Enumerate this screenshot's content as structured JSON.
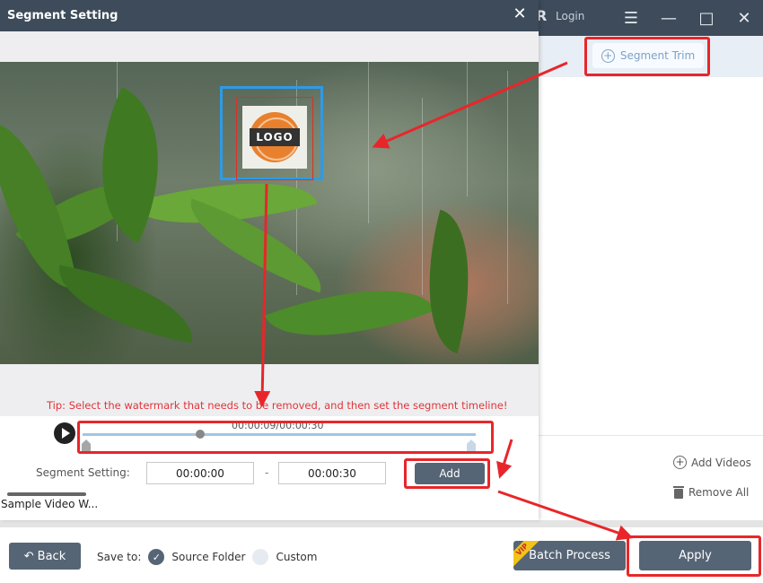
{
  "app": {
    "login_label": "Login",
    "toolbar": {
      "segment_trim_label": "Segment Trim"
    },
    "side_actions": {
      "add_videos_label": "Add Videos",
      "remove_all_label": "Remove All"
    },
    "footer": {
      "back_label": "Back",
      "save_to_label": "Save to:",
      "save_options": [
        {
          "label": "Source Folder",
          "selected": true
        },
        {
          "label": "Custom",
          "selected": false
        }
      ],
      "batch_process_label": "Batch Process",
      "vip_badge": "VIP",
      "apply_label": "Apply"
    },
    "thumbnail_name": "Sample Video W..."
  },
  "dialog": {
    "title": "Segment Setting",
    "watermark_logo_text": "LOGO",
    "tip": "Tip: Select the watermark that needs to be removed, and then set the segment timeline!",
    "timeline": {
      "current_time": "00:00:09",
      "total_time": "00:00:30",
      "readout": "00:00:09/00:00:30",
      "progress_fraction": 0.3
    },
    "segment": {
      "label": "Segment Setting:",
      "start": "00:00:00",
      "separator": "-",
      "end": "00:00:30",
      "add_label": "Add"
    }
  },
  "colors": {
    "header_bg": "#3d4b5a",
    "button_bg": "#566575",
    "annotation_red": "#e8262a",
    "selection_blue": "#2f9ae6",
    "tip_red": "#e0353a"
  }
}
